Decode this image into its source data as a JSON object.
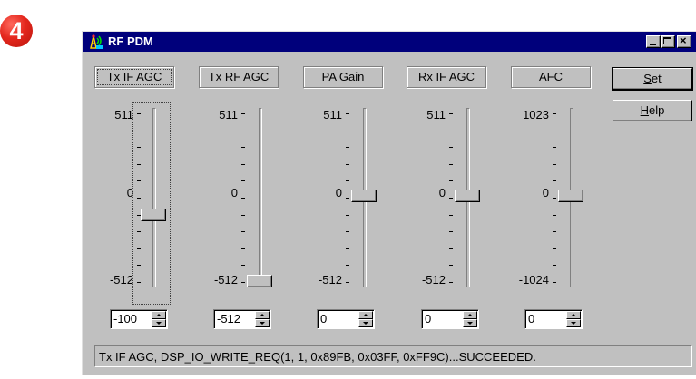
{
  "step_badge": "4",
  "window": {
    "title": "RF PDM",
    "icon": "antenna-app-icon",
    "caption_buttons": [
      "minimize",
      "maximize",
      "close"
    ],
    "close_glyph": "×"
  },
  "controls": [
    {
      "label": "Tx IF AGC",
      "max_label": "511",
      "zero_label": "0",
      "min_label": "-512",
      "value": "-100",
      "focused": true
    },
    {
      "label": "Tx RF AGC",
      "max_label": "511",
      "zero_label": "0",
      "min_label": "-512",
      "value": "-512",
      "focused": false
    },
    {
      "label": "PA Gain",
      "max_label": "511",
      "zero_label": "0",
      "min_label": "-512",
      "value": "0",
      "focused": false
    },
    {
      "label": "Rx IF AGC",
      "max_label": "511",
      "zero_label": "0",
      "min_label": "-512",
      "value": "0",
      "focused": false
    },
    {
      "label": "AFC",
      "max_label": "1023",
      "zero_label": "0",
      "min_label": "-1024",
      "value": "0",
      "focused": false
    }
  ],
  "buttons": {
    "set": {
      "mnemonic": "S",
      "rest": "et"
    },
    "help": {
      "mnemonic": "H",
      "rest": "elp"
    }
  },
  "status_text": "Tx IF AGC, DSP_IO_WRITE_REQ(1, 1, 0x89FB, 0x03FF, 0xFF9C)...SUCCEEDED.",
  "colors": {
    "title_bar": "#00007b",
    "face": "#c0c0c0",
    "badge": "#e4271d"
  }
}
